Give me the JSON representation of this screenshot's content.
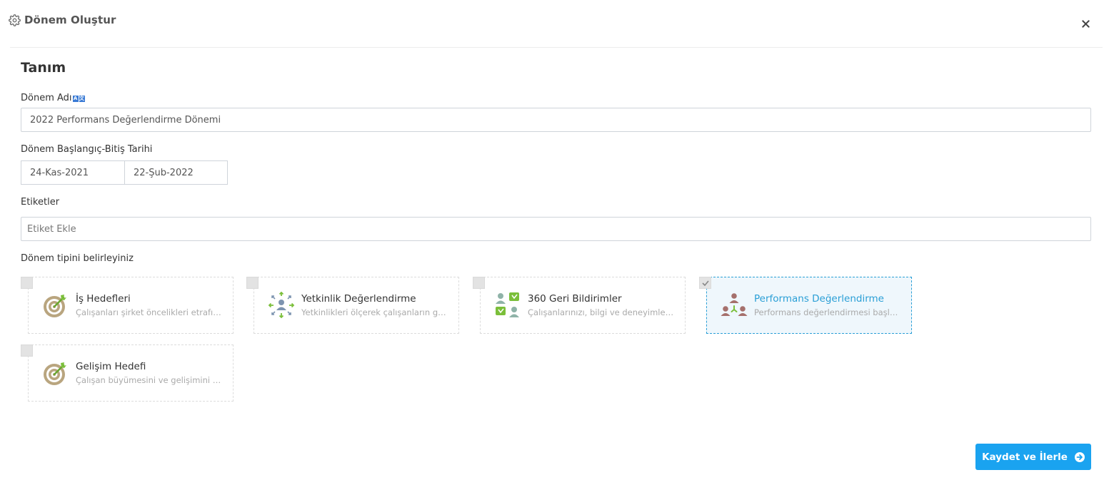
{
  "header": {
    "title": "Dönem Oluştur",
    "title_icon": "gear-icon",
    "close_icon": "close-icon"
  },
  "definition": {
    "section_title": "Tanım",
    "name_label": "Dönem Adı",
    "name_label_badge": [
      "A",
      "文"
    ],
    "name_value": "2022 Performans Değerlendirme Dönemi",
    "dates_label": "Dönem Başlangıç-Bitiş Tarihi",
    "start_date": "24-Kas-2021",
    "end_date": "22-Şub-2022",
    "tags_label": "Etiketler",
    "tags_placeholder": "Etiket Ekle"
  },
  "period_type": {
    "label": "Dönem tipini belirleyiniz",
    "cards": [
      {
        "title": "İş Hedefleri",
        "description": "Çalışanları şirket öncelikleri etrafında hizalayın",
        "icon": "target-icon",
        "selected": false
      },
      {
        "title": "Yetkinlik Değerlendirme",
        "description": "Yetkinlikleri ölçerek çalışanların gelişimini izleyin",
        "icon": "competency-icon",
        "selected": false
      },
      {
        "title": "360 Geri Bildirimler",
        "description": "Çalışanlarınızı, bilgi ve deneyimlerine göre değerlendirin",
        "icon": "feedback-360-icon",
        "selected": false
      },
      {
        "title": "Performans Değerlendirme",
        "description": "Performans değerlendirmesi başlatın",
        "icon": "performance-team-icon",
        "selected": true
      },
      {
        "title": "Gelişim Hedefi",
        "description": "Çalışan büyümesini ve gelişimini destekleyin",
        "icon": "target-icon",
        "selected": false
      }
    ]
  },
  "footer": {
    "save_label": "Kaydet ve İlerle",
    "save_icon": "arrow-right-circle-icon"
  },
  "colors": {
    "accent": "#1aa3f0",
    "selected_border": "#2a9fd6",
    "selected_bg": "#eff7fc"
  }
}
